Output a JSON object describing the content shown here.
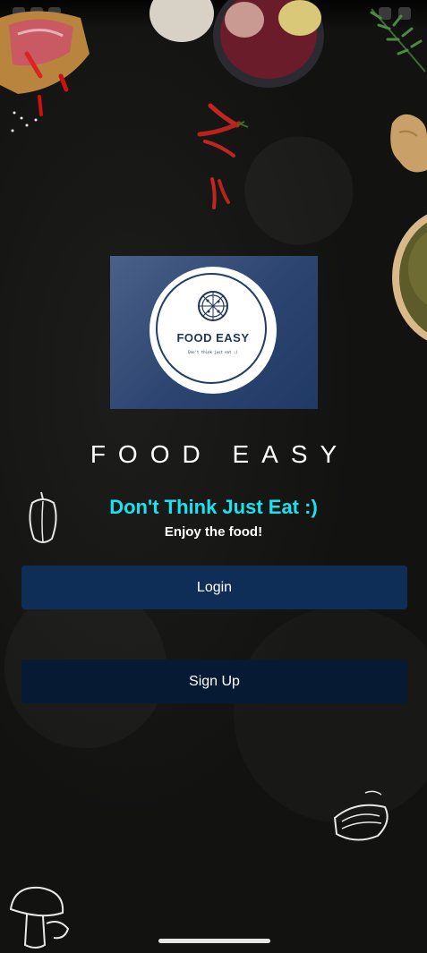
{
  "status_bar": {
    "left_icons": [
      "notification-icon",
      "shield-icon",
      "sim-icon"
    ],
    "right_icons": [
      "wifi-icon",
      "battery-icon"
    ]
  },
  "logo": {
    "name": "FOOD EASY",
    "tagline": "Don't think just eat :)",
    "icon": "pizza-icon"
  },
  "app_title": "FOOD EASY",
  "tagline": "Don't Think Just Eat :)",
  "subtitle": "Enjoy the food!",
  "buttons": {
    "login": "Login",
    "signup": "Sign Up"
  },
  "colors": {
    "background": "#121211",
    "tagline": "#19e3ef",
    "login_button": "#0f2e57",
    "signup_button": "#061a33",
    "logo_card": "#2c4470"
  },
  "decorations": [
    "meat-board-image",
    "bean-bowl-image",
    "chili-peppers-image",
    "herbs-image",
    "ginger-image",
    "lentil-bowl-image",
    "pepper-sketch-icon",
    "bread-sketch-icon",
    "mushroom-sketch-icon"
  ]
}
